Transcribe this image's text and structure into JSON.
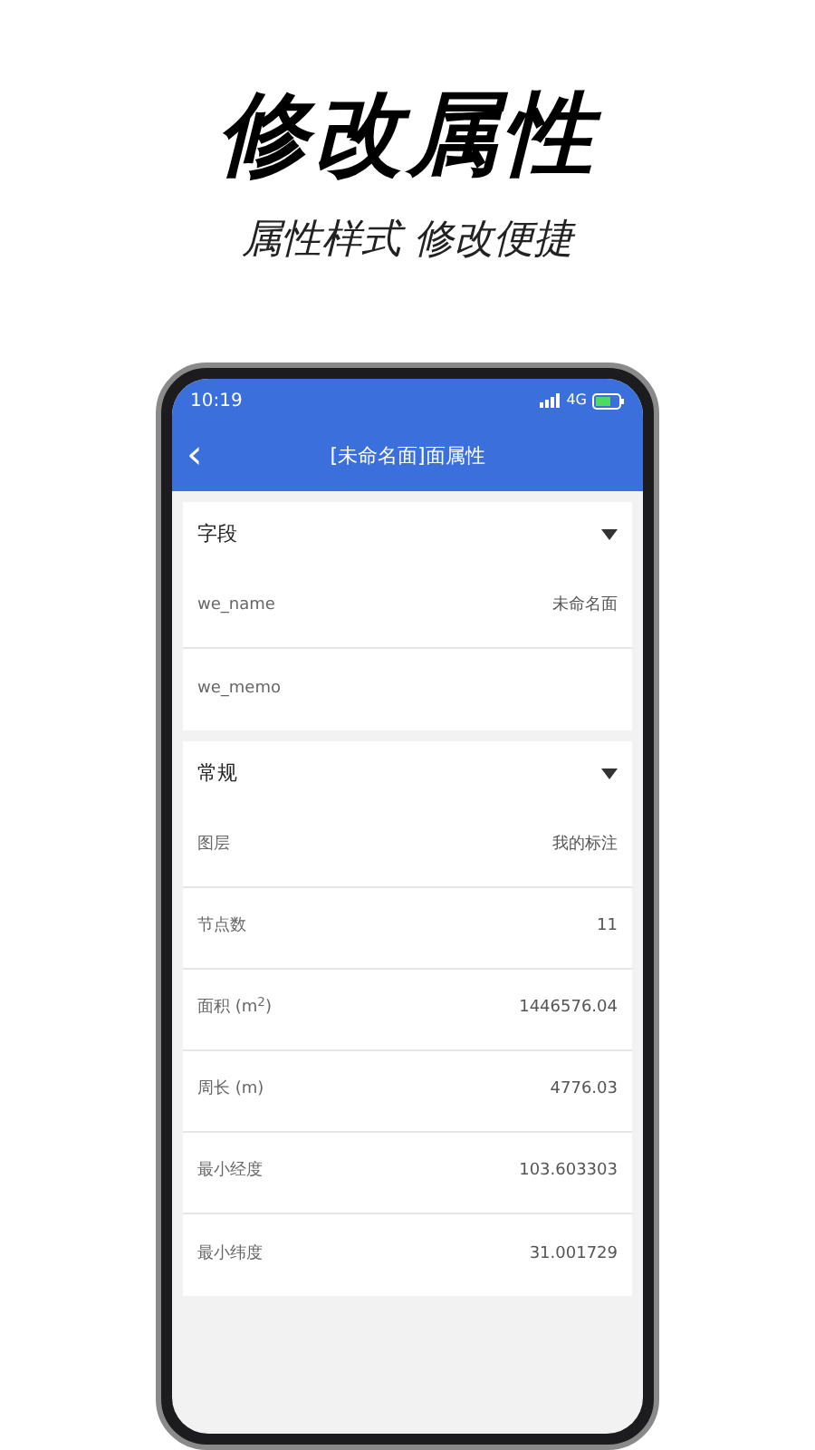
{
  "promo": {
    "title": "修改属性",
    "subtitle": "属性样式 修改便捷"
  },
  "status_bar": {
    "time": "10:19",
    "network": "4G"
  },
  "nav": {
    "back": "‹",
    "title": "[未命名面]面属性"
  },
  "sections": [
    {
      "title": "字段",
      "expanded": true,
      "rows": [
        {
          "label": "we_name",
          "value": "未命名面"
        },
        {
          "label": "we_memo"
        }
      ]
    },
    {
      "title": "常规",
      "expanded": true,
      "rows": [
        {
          "label": "图层",
          "value": "我的标注"
        },
        {
          "label": "节点数",
          "value": "11"
        },
        {
          "label": "面积 (m$^{2}$)",
          "value": "1446576.04"
        },
        {
          "label": "周长 (m)",
          "value": "4776.03"
        },
        {
          "label": "最小经度",
          "value": "103.603303"
        },
        {
          "label": "最小纬度",
          "value": "31.001729"
        }
      ]
    }
  ]
}
